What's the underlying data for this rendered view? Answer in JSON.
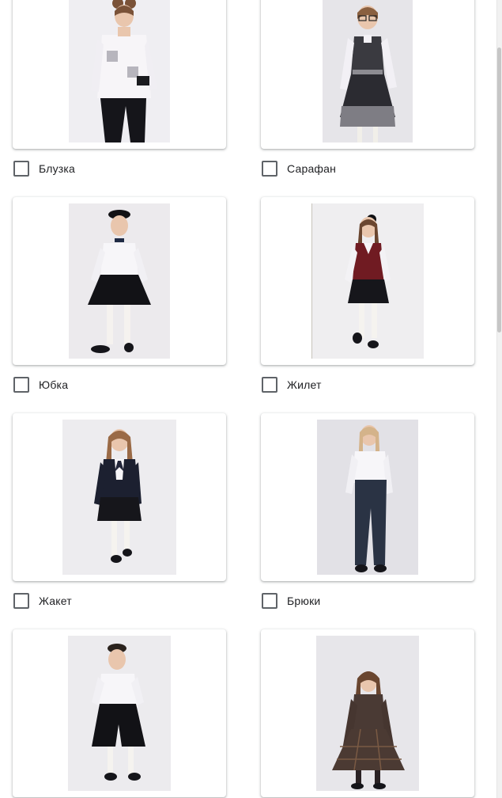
{
  "options": [
    {
      "label": "Блузка",
      "image": "girl-in-white-blouse-photo",
      "photo_width": 128,
      "bg": "#efeef2"
    },
    {
      "label": "Сарафан",
      "image": "girl-in-gray-sundress-photo",
      "photo_width": 114,
      "bg": "#e6e5e9"
    },
    {
      "label": "Юбка",
      "image": "girl-in-black-skirt-photo",
      "photo_width": 128,
      "bg": "#eceaed"
    },
    {
      "label": "Жилет",
      "image": "girl-in-burgundy-vest-photo",
      "photo_width": 142,
      "bg": "#efeef0"
    },
    {
      "label": "Жакет",
      "image": "girl-in-navy-jacket-photo",
      "photo_width": 144,
      "bg": "#edecef"
    },
    {
      "label": "Брюки",
      "image": "girl-in-navy-trousers-photo",
      "photo_width": 128,
      "bg": "#e2e1e6"
    },
    {
      "label": "",
      "image": "girl-in-black-culottes-photo",
      "photo_width": 130,
      "bg": "#ecebee"
    },
    {
      "label": "",
      "image": "girl-in-plaid-dress-photo",
      "photo_width": 130,
      "bg": "#e7e6ea"
    }
  ],
  "colors": {
    "checkbox_border": "#5f6368",
    "label_text": "#202124",
    "card_bg": "#ffffff"
  }
}
